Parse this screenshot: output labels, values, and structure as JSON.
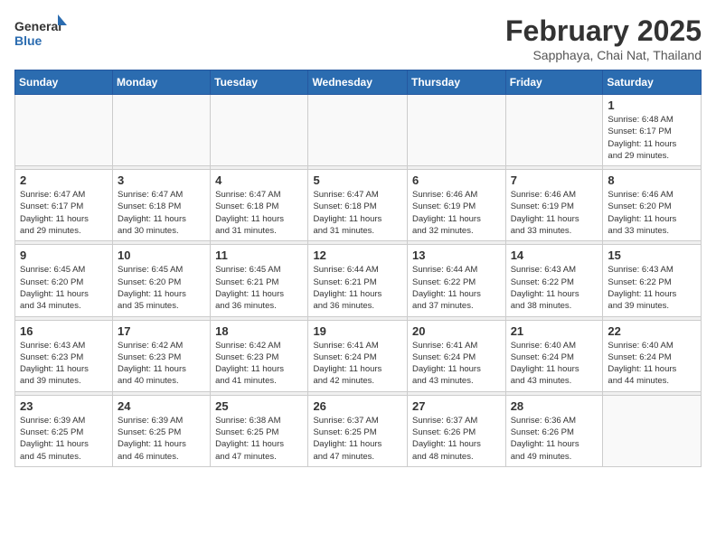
{
  "header": {
    "logo_general": "General",
    "logo_blue": "Blue",
    "month_year": "February 2025",
    "location": "Sapphaya, Chai Nat, Thailand"
  },
  "weekdays": [
    "Sunday",
    "Monday",
    "Tuesday",
    "Wednesday",
    "Thursday",
    "Friday",
    "Saturday"
  ],
  "weeks": [
    [
      {
        "day": "",
        "info": ""
      },
      {
        "day": "",
        "info": ""
      },
      {
        "day": "",
        "info": ""
      },
      {
        "day": "",
        "info": ""
      },
      {
        "day": "",
        "info": ""
      },
      {
        "day": "",
        "info": ""
      },
      {
        "day": "1",
        "info": "Sunrise: 6:48 AM\nSunset: 6:17 PM\nDaylight: 11 hours\nand 29 minutes."
      }
    ],
    [
      {
        "day": "2",
        "info": "Sunrise: 6:47 AM\nSunset: 6:17 PM\nDaylight: 11 hours\nand 29 minutes."
      },
      {
        "day": "3",
        "info": "Sunrise: 6:47 AM\nSunset: 6:18 PM\nDaylight: 11 hours\nand 30 minutes."
      },
      {
        "day": "4",
        "info": "Sunrise: 6:47 AM\nSunset: 6:18 PM\nDaylight: 11 hours\nand 31 minutes."
      },
      {
        "day": "5",
        "info": "Sunrise: 6:47 AM\nSunset: 6:18 PM\nDaylight: 11 hours\nand 31 minutes."
      },
      {
        "day": "6",
        "info": "Sunrise: 6:46 AM\nSunset: 6:19 PM\nDaylight: 11 hours\nand 32 minutes."
      },
      {
        "day": "7",
        "info": "Sunrise: 6:46 AM\nSunset: 6:19 PM\nDaylight: 11 hours\nand 33 minutes."
      },
      {
        "day": "8",
        "info": "Sunrise: 6:46 AM\nSunset: 6:20 PM\nDaylight: 11 hours\nand 33 minutes."
      }
    ],
    [
      {
        "day": "9",
        "info": "Sunrise: 6:45 AM\nSunset: 6:20 PM\nDaylight: 11 hours\nand 34 minutes."
      },
      {
        "day": "10",
        "info": "Sunrise: 6:45 AM\nSunset: 6:20 PM\nDaylight: 11 hours\nand 35 minutes."
      },
      {
        "day": "11",
        "info": "Sunrise: 6:45 AM\nSunset: 6:21 PM\nDaylight: 11 hours\nand 36 minutes."
      },
      {
        "day": "12",
        "info": "Sunrise: 6:44 AM\nSunset: 6:21 PM\nDaylight: 11 hours\nand 36 minutes."
      },
      {
        "day": "13",
        "info": "Sunrise: 6:44 AM\nSunset: 6:22 PM\nDaylight: 11 hours\nand 37 minutes."
      },
      {
        "day": "14",
        "info": "Sunrise: 6:43 AM\nSunset: 6:22 PM\nDaylight: 11 hours\nand 38 minutes."
      },
      {
        "day": "15",
        "info": "Sunrise: 6:43 AM\nSunset: 6:22 PM\nDaylight: 11 hours\nand 39 minutes."
      }
    ],
    [
      {
        "day": "16",
        "info": "Sunrise: 6:43 AM\nSunset: 6:23 PM\nDaylight: 11 hours\nand 39 minutes."
      },
      {
        "day": "17",
        "info": "Sunrise: 6:42 AM\nSunset: 6:23 PM\nDaylight: 11 hours\nand 40 minutes."
      },
      {
        "day": "18",
        "info": "Sunrise: 6:42 AM\nSunset: 6:23 PM\nDaylight: 11 hours\nand 41 minutes."
      },
      {
        "day": "19",
        "info": "Sunrise: 6:41 AM\nSunset: 6:24 PM\nDaylight: 11 hours\nand 42 minutes."
      },
      {
        "day": "20",
        "info": "Sunrise: 6:41 AM\nSunset: 6:24 PM\nDaylight: 11 hours\nand 43 minutes."
      },
      {
        "day": "21",
        "info": "Sunrise: 6:40 AM\nSunset: 6:24 PM\nDaylight: 11 hours\nand 43 minutes."
      },
      {
        "day": "22",
        "info": "Sunrise: 6:40 AM\nSunset: 6:24 PM\nDaylight: 11 hours\nand 44 minutes."
      }
    ],
    [
      {
        "day": "23",
        "info": "Sunrise: 6:39 AM\nSunset: 6:25 PM\nDaylight: 11 hours\nand 45 minutes."
      },
      {
        "day": "24",
        "info": "Sunrise: 6:39 AM\nSunset: 6:25 PM\nDaylight: 11 hours\nand 46 minutes."
      },
      {
        "day": "25",
        "info": "Sunrise: 6:38 AM\nSunset: 6:25 PM\nDaylight: 11 hours\nand 47 minutes."
      },
      {
        "day": "26",
        "info": "Sunrise: 6:37 AM\nSunset: 6:25 PM\nDaylight: 11 hours\nand 47 minutes."
      },
      {
        "day": "27",
        "info": "Sunrise: 6:37 AM\nSunset: 6:26 PM\nDaylight: 11 hours\nand 48 minutes."
      },
      {
        "day": "28",
        "info": "Sunrise: 6:36 AM\nSunset: 6:26 PM\nDaylight: 11 hours\nand 49 minutes."
      },
      {
        "day": "",
        "info": ""
      }
    ]
  ]
}
